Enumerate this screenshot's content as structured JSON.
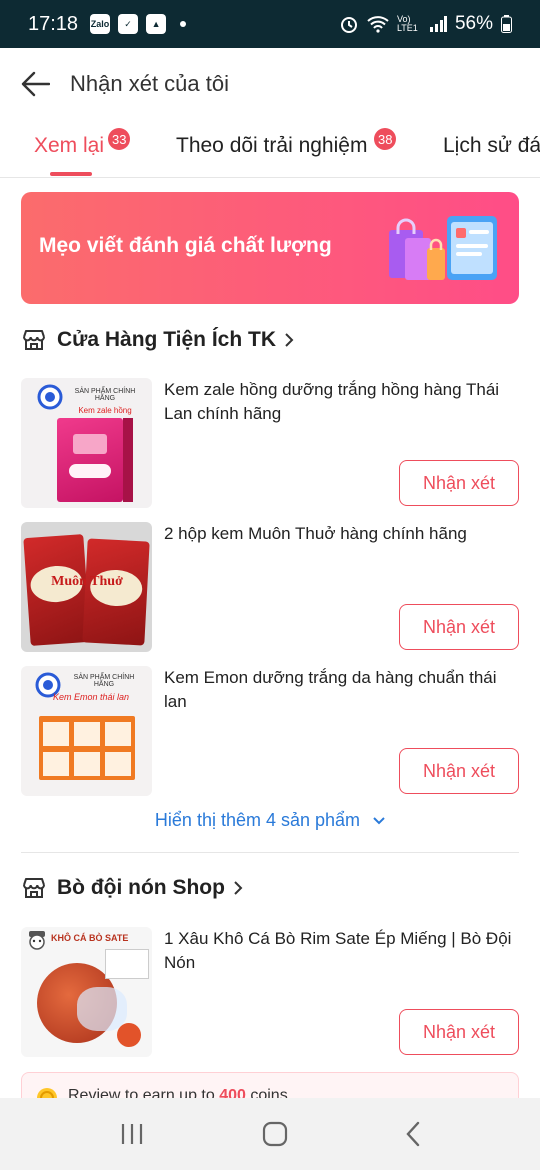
{
  "status": {
    "time": "17:18",
    "battery": "56%",
    "zalo": "Zalo",
    "lte": "Vo) LTE1"
  },
  "header": {
    "title": "Nhận xét của tôi"
  },
  "tabs": [
    {
      "label": "Xem lại",
      "badge": "33"
    },
    {
      "label": "Theo dõi trải nghiệm",
      "badge": "38"
    },
    {
      "label": "Lịch sử đá"
    }
  ],
  "banner": {
    "text": "Mẹo viết đánh giá chất lượng"
  },
  "shops": [
    {
      "name": "Cửa Hàng Tiện Ích TK",
      "products": [
        {
          "name": "Kem zale hồng dưỡng trắng hồng hàng Thái Lan chính hãng",
          "thumb_title": "SẢN PHẨM CHÍNH HÃNG",
          "thumb_sub": "Kem zale hồng"
        },
        {
          "name": "2 hộp kem Muôn Thuở hàng chính hãng",
          "thumb_title": "Muôn Thuở"
        },
        {
          "name": "Kem Emon dưỡng trắng da hàng chuẩn thái lan",
          "thumb_title": "SẢN PHẨM CHÍNH HÃNG",
          "thumb_sub": "Kem Emon thái lan"
        }
      ],
      "show_more": "Hiển thị thêm 4 sản phẩm"
    },
    {
      "name": "Bò đội nón Shop",
      "products": [
        {
          "name": "1 Xâu Khô Cá Bò Rim Sate Ép Miếng | Bò Đội Nón",
          "thumb_title": "KHÔ CÁ BÒ SATE"
        }
      ]
    }
  ],
  "review_label": "Nhận xét",
  "coin_banner": {
    "prefix": "Review to earn up to ",
    "amount": "400",
    "suffix": " coins"
  },
  "colors": {
    "accent": "#ee4d5c",
    "link": "#2a7ad9",
    "statusbar": "#0d2a33"
  }
}
